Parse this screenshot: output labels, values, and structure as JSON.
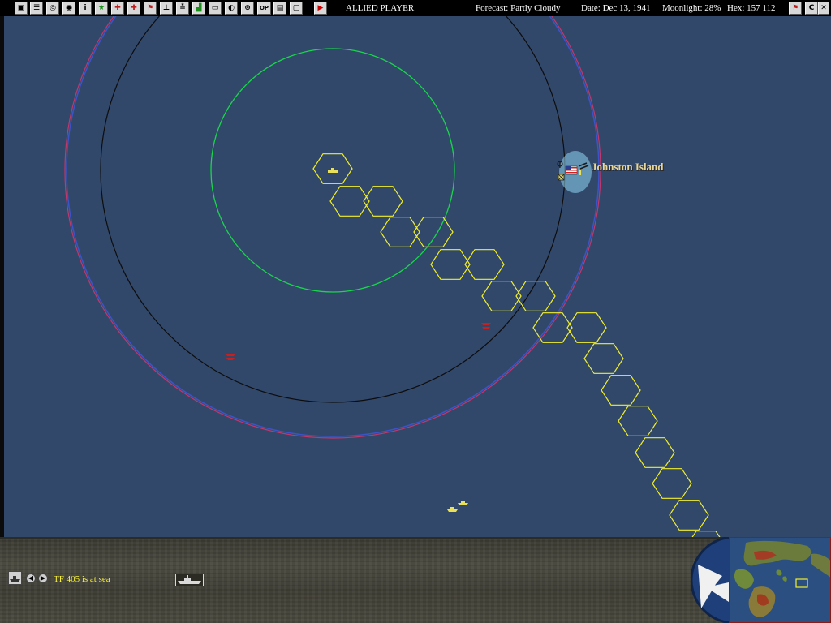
{
  "toolbar": {
    "player": "ALLIED PLAYER",
    "forecast": "Forecast: Partly Cloudy",
    "date": "Date: Dec 13, 1941",
    "moonlight": "Moonlight: 28%",
    "hex": "Hex: 157 112",
    "right_buttons": [
      "C"
    ],
    "op_button": "OP"
  },
  "map": {
    "place_name": "Johnston Island",
    "colors": {
      "ocean": "#31486a",
      "hex_path": "#f2ef2a",
      "ring_green": "#19d64a",
      "ring_black": "#0d0d0d",
      "ring_outer": "#c2386a",
      "enemy_marker": "#c62020"
    }
  },
  "bottom_panel": {
    "status_text": "TF 405 is at sea"
  }
}
